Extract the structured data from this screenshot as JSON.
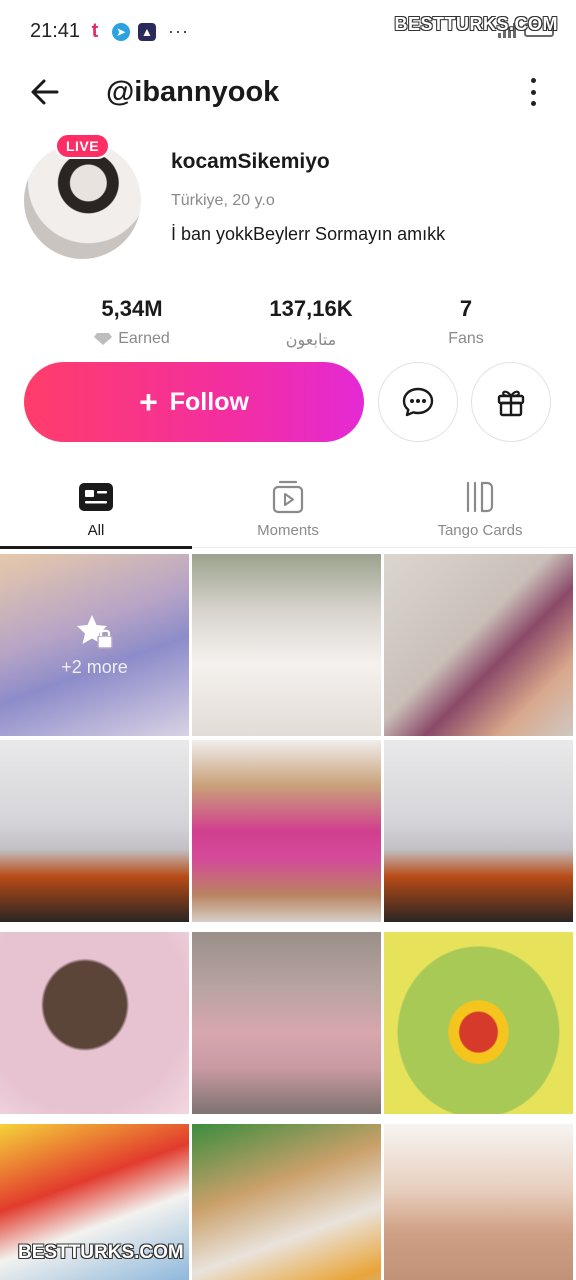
{
  "status_bar": {
    "time": "21:41",
    "app_icons": [
      "tango-icon",
      "telegram-icon",
      "app-icon"
    ],
    "overflow": "···",
    "watermark": "BESTTURKS.COM"
  },
  "header": {
    "handle": "@ibannyook"
  },
  "profile": {
    "live_badge": "LIVE",
    "display_name": "kocamSikemiyo",
    "location": "Türkiye, 20 y.o",
    "bio": "İ ban yokkBeylerr Sormayın amıkk"
  },
  "stats": [
    {
      "value": "5,34M",
      "label": "Earned",
      "icon": "diamond-icon"
    },
    {
      "value": "137,16K",
      "label": "متابعون"
    },
    {
      "value": "7",
      "label": "Fans"
    }
  ],
  "actions": {
    "follow_label": "Follow"
  },
  "tabs": [
    {
      "label": "All",
      "icon": "profile-card-icon",
      "active": true
    },
    {
      "label": "Moments",
      "icon": "play-stack-icon",
      "active": false
    },
    {
      "label": "Tango Cards",
      "icon": "cards-icon",
      "active": false
    }
  ],
  "grid": {
    "locked_tile_text": "+2 more",
    "watermark": "BESTTURKS.COM",
    "tiles": [
      "locked",
      "photo",
      "photo",
      "photo",
      "photo",
      "photo",
      "photo",
      "photo",
      "photo",
      "photo",
      "photo",
      "photo"
    ]
  },
  "colors": {
    "follow_gradient_start": "#ff3d6a",
    "follow_gradient_end": "#e42ad5",
    "live_badge": "#ff2d66",
    "muted_text": "#8a8a8a"
  }
}
